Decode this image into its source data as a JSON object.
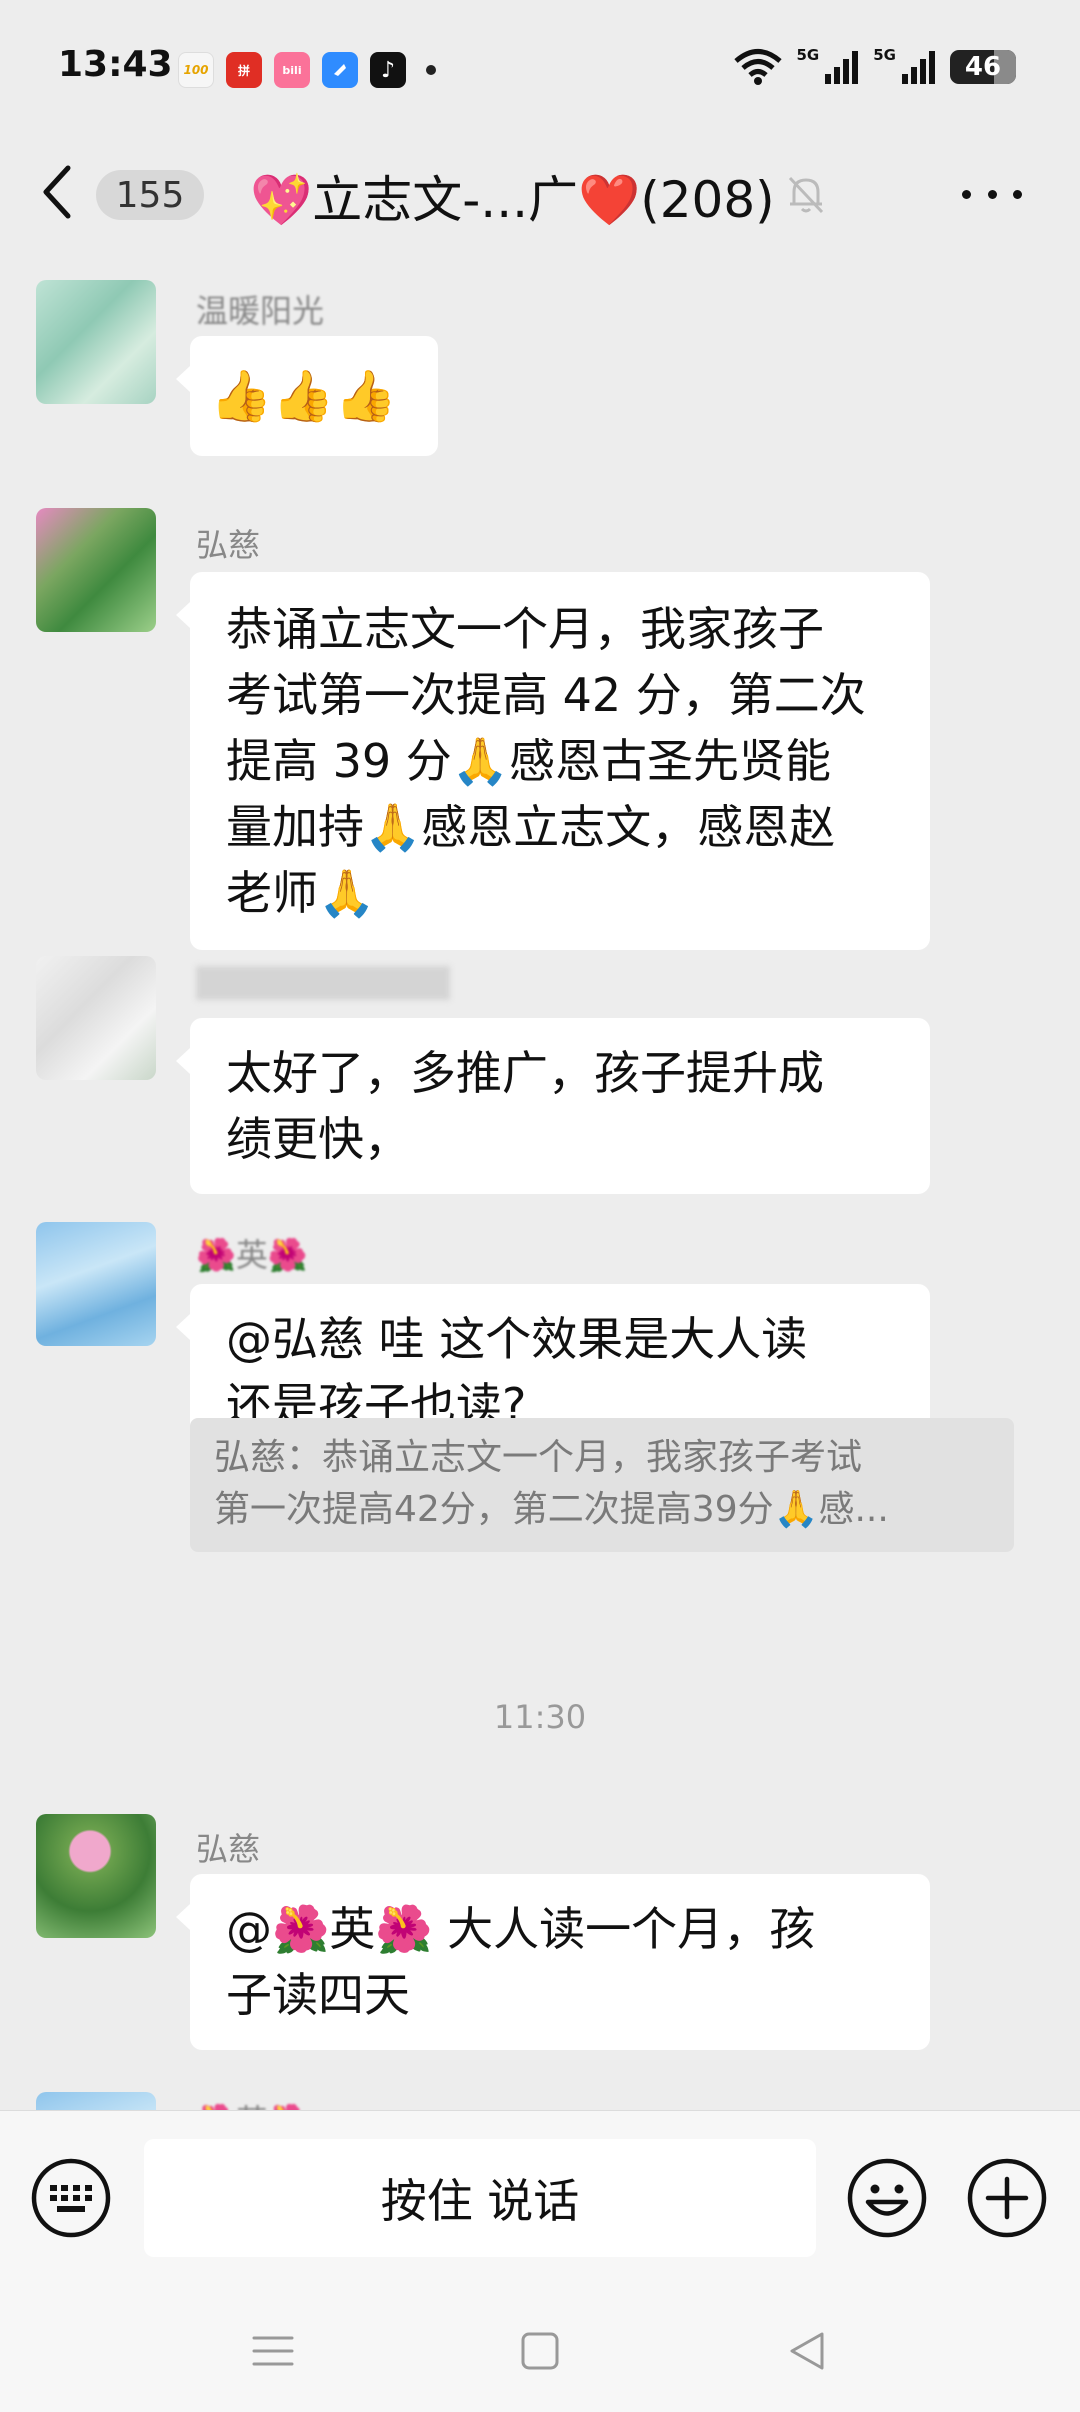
{
  "status_bar": {
    "time": "13:43",
    "app_icons": [
      {
        "name": "icon-100",
        "label": "100",
        "color": "#f6f6f6"
      },
      {
        "name": "pinduoduo-icon",
        "label": "拼",
        "color": "#e02e24"
      },
      {
        "name": "bilibili-icon",
        "label": "bili",
        "color": "#fb7299"
      },
      {
        "name": "blue-app-icon",
        "label": "",
        "color": "#2f8cff"
      },
      {
        "name": "tiktok-icon",
        "label": "♪",
        "color": "#111111"
      }
    ],
    "network_1": "5G",
    "network_2": "5G",
    "battery": "46"
  },
  "header": {
    "unread_count": "155",
    "title": "💖立志文-...广❤️(208)"
  },
  "messages": [
    {
      "sender": "温暖阳光",
      "text": "👍👍👍"
    },
    {
      "sender": "弘慈",
      "lines": [
        "恭诵立志文一个月，我家孩子",
        "考试第一次提高 42 分，第二次",
        "提高 39 分🙏感恩古圣先贤能",
        "量加持🙏感恩立志文，感恩赵",
        "老师🙏"
      ]
    },
    {
      "sender": "",
      "lines": [
        "太好了，多推广，孩子提升成",
        "绩更快，"
      ]
    },
    {
      "sender": "🌺英🌺",
      "lines": [
        "@弘慈  哇  这个效果是大人读",
        "还是孩子也读?"
      ],
      "quote_lines": [
        "弘慈：恭诵立志文一个月，我家孩子考试",
        "第一次提高42分，第二次提高39分🙏感..."
      ]
    },
    {
      "sender": "弘慈",
      "lines": [
        "@🌺英🌺  大人读一个月，孩",
        "子读四天"
      ]
    },
    {
      "sender": "🌺英🌺"
    }
  ],
  "time_separator": "11:30",
  "input": {
    "hold_to_talk": "按住 说话"
  },
  "colors": {
    "background": "#ededed",
    "bubble": "#ffffff",
    "quote": "#e1e1e1"
  }
}
